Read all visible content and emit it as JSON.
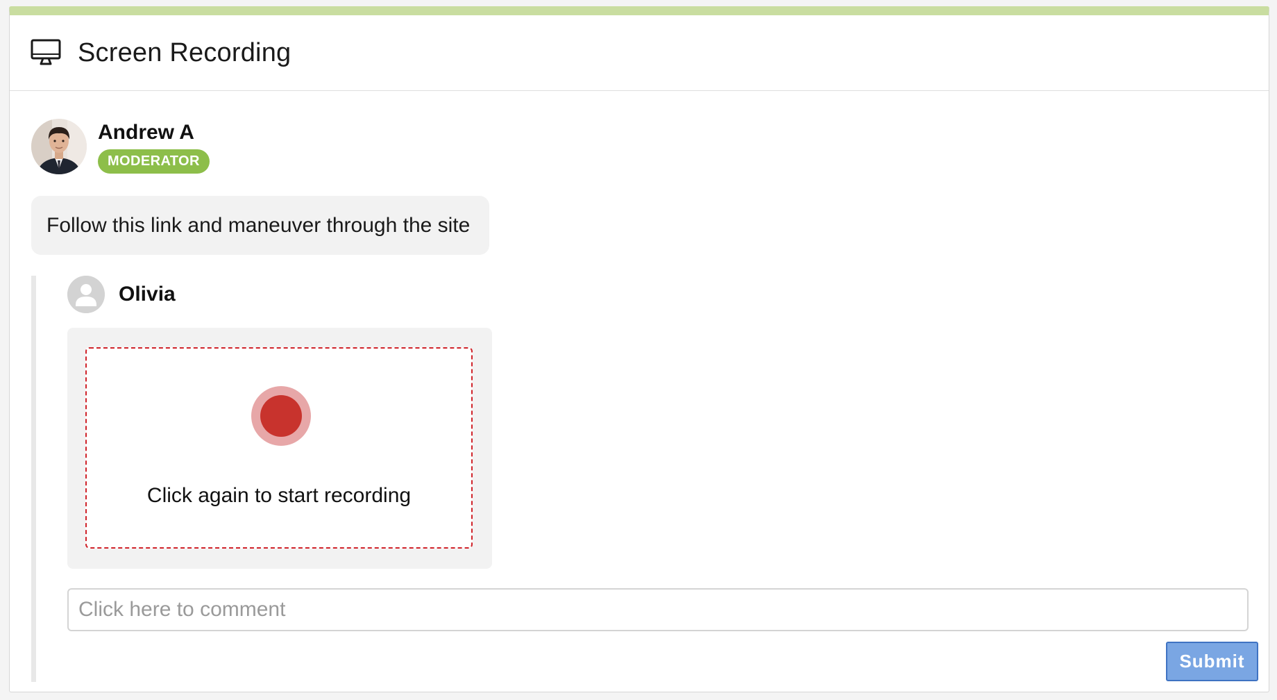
{
  "header": {
    "icon": "monitor-icon",
    "title": "Screen Recording"
  },
  "post": {
    "author": {
      "name": "Andrew A",
      "role_badge": "MODERATOR",
      "avatar": "profile-photo"
    },
    "message": "Follow this link and maneuver through the site"
  },
  "reply": {
    "author": {
      "name": "Olivia",
      "avatar": "user-placeholder-icon"
    },
    "recorder": {
      "icon": "record-icon",
      "caption": "Click again to start recording"
    },
    "comment": {
      "placeholder": "Click here to comment",
      "value": ""
    },
    "submit_label": "Submit"
  },
  "colors": {
    "header_accent": "#c9dda0",
    "badge": "#8dbe4a",
    "record_red": "#c8332d",
    "dashed_border": "#d0232a",
    "submit_button": "#7aa6e3"
  }
}
